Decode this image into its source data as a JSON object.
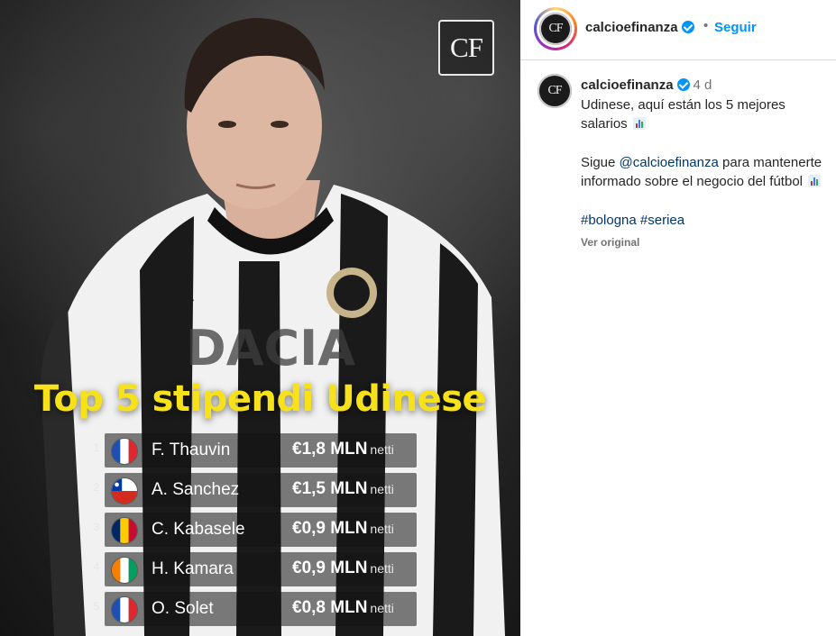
{
  "post_image": {
    "logo_text": "CF",
    "headline": "Top 5 stipendi Udinese",
    "rows": [
      {
        "rank": "1",
        "flag": "france-flag",
        "name": "F. Thauvin",
        "amount": "€1,8 MLN",
        "unit": "netti"
      },
      {
        "rank": "2",
        "flag": "chile-flag",
        "name": "A. Sanchez",
        "amount": "€1,5 MLN",
        "unit": "netti"
      },
      {
        "rank": "3",
        "flag": "chad-flag",
        "name": "C. Kabasele",
        "amount": "€0,9 MLN",
        "unit": "netti"
      },
      {
        "rank": "4",
        "flag": "ivory-coast-flag",
        "name": "H. Kamara",
        "amount": "€0,9 MLN",
        "unit": "netti"
      },
      {
        "rank": "5",
        "flag": "france-flag",
        "name": "O. Solet",
        "amount": "€0,8 MLN",
        "unit": "netti"
      }
    ],
    "colors": {
      "headline": "#f7e21a"
    }
  },
  "header": {
    "avatar_text": "CF",
    "username": "calcioefinanza",
    "separator": "•",
    "follow_label": "Seguir"
  },
  "caption": {
    "avatar_text": "CF",
    "username": "calcioefinanza",
    "time": "4 d",
    "line1": "Udinese, aquí están los 5 mejores salarios",
    "follow_prefix": "Sigue",
    "mention": "@calcioefinanza",
    "follow_suffix": "para mantenerte informado sobre el negocio del fútbol",
    "hashtag1": "#bologna",
    "hashtag2": "#seriea",
    "see_original": "Ver original"
  },
  "colors": {
    "link": "#0095f6",
    "verified": "#0095f6",
    "hashtag": "#00376b"
  }
}
